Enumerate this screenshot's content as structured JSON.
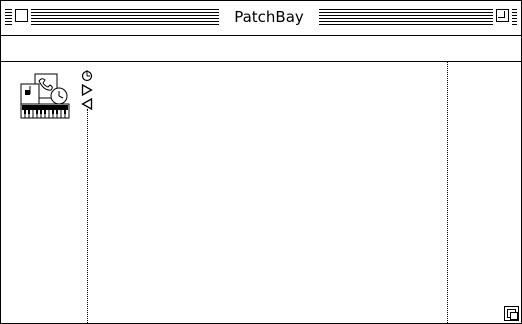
{
  "window": {
    "title": "PatchBay"
  },
  "infobar": {
    "text": ""
  },
  "icons": {
    "close_box": "close-box-icon",
    "zoom_box": "zoom-box-icon",
    "device": "midi-device-icon",
    "clock_port": "clock-icon",
    "output_port": "triangle-right-icon",
    "input_port": "triangle-left-icon",
    "grow_box": "resize-icon"
  },
  "colors": {
    "foreground": "#000000",
    "background": "#ffffff"
  }
}
